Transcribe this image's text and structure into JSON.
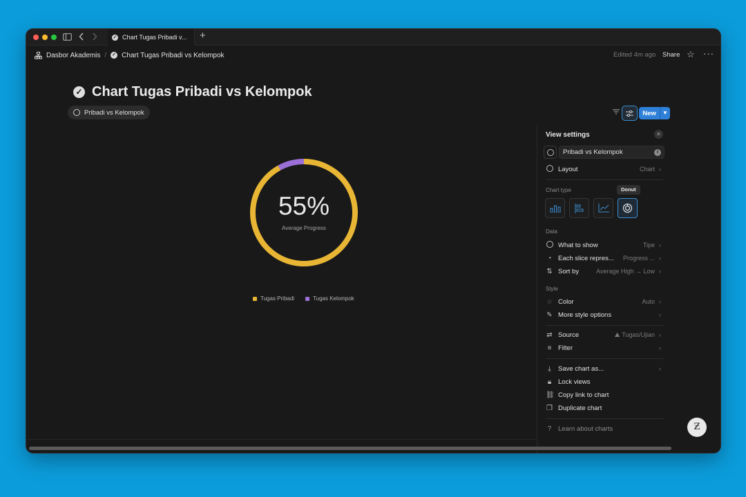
{
  "tab": {
    "title": "Chart Tugas Pribadi v..."
  },
  "breadcrumb": {
    "workspace": "Dasbor Akademis",
    "page": "Chart Tugas Pribadi vs Kelompok"
  },
  "topbar": {
    "edited": "Edited 4m ago",
    "share": "Share"
  },
  "page": {
    "title": "Chart Tugas Pribadi vs Kelompok",
    "view_tab": "Pribadi vs Kelompok"
  },
  "toolbar": {
    "new_label": "New"
  },
  "chart": {
    "center_value": "55%",
    "center_label": "Average Progress"
  },
  "chart_data": {
    "type": "pie",
    "variant": "donut",
    "categories": [
      "Tugas Pribadi",
      "Tugas Kelompok"
    ],
    "values": [
      92,
      8
    ],
    "colors": [
      "#e8b634",
      "#9b6fd8"
    ],
    "legend_position": "bottom"
  },
  "panel": {
    "title": "View settings",
    "view_name": "Pribadi vs Kelompok",
    "layout": {
      "label": "Layout",
      "value": "Chart"
    },
    "chart_type_section": "Chart type",
    "tooltip": "Donut",
    "data_section": "Data",
    "what_to_show": {
      "label": "What to show",
      "value": "Tipe"
    },
    "each_slice": {
      "label": "Each slice repres...",
      "value": "Progress ..."
    },
    "sort_by": {
      "label": "Sort by",
      "value": "Average High → Low"
    },
    "style_section": "Style",
    "color": {
      "label": "Color",
      "value": "Auto"
    },
    "more_style": {
      "label": "More style options"
    },
    "source": {
      "label": "Source",
      "value": "Tugas/Ujian"
    },
    "filter": {
      "label": "Filter"
    },
    "save_chart": {
      "label": "Save chart as..."
    },
    "lock_views": {
      "label": "Lock views"
    },
    "copy_link": {
      "label": "Copy link to chart"
    },
    "duplicate": {
      "label": "Duplicate chart"
    },
    "learn": {
      "label": "Learn about charts"
    }
  },
  "help_glyph": "Ƶ",
  "colors": {
    "accent": "#2f80d8",
    "selection": "#3c8fd4",
    "background": "#191919",
    "desktop": "#0b9cdb"
  }
}
